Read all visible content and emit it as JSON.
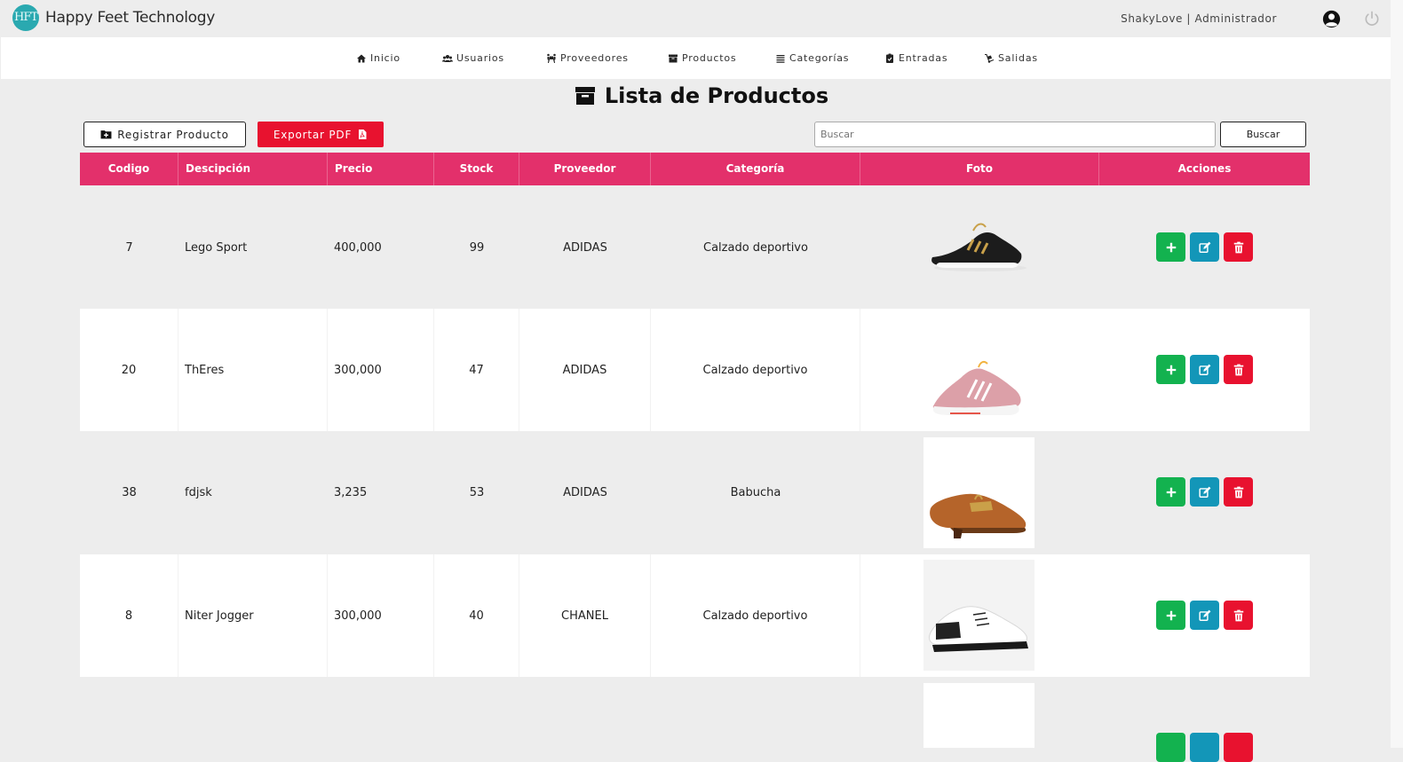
{
  "header": {
    "logo_text": "HFT",
    "brand": "Happy Feet Technology",
    "user": "ShakyLove | Administrador"
  },
  "nav": [
    {
      "label": "Inicio",
      "icon": "home-icon"
    },
    {
      "label": "Usuarios",
      "icon": "users-icon"
    },
    {
      "label": "Proveedores",
      "icon": "people-carry-icon"
    },
    {
      "label": "Productos",
      "icon": "archive-icon"
    },
    {
      "label": "Categorías",
      "icon": "list-icon"
    },
    {
      "label": "Entradas",
      "icon": "clipboard-check-icon"
    },
    {
      "label": "Salidas",
      "icon": "dolly-icon"
    }
  ],
  "page": {
    "title": "Lista de Productos",
    "register_label": "Registrar Producto",
    "export_label": "Exportar PDF",
    "search_placeholder": "Buscar",
    "search_button": "Buscar"
  },
  "table": {
    "columns": [
      "Codigo",
      "Descipción",
      "Precio",
      "Stock",
      "Proveedor",
      "Categoría",
      "Foto",
      "Acciones"
    ],
    "rows": [
      {
        "codigo": "7",
        "descripcion": "Lego Sport",
        "precio": "400,000",
        "stock": "99",
        "proveedor": "ADIDAS",
        "categoria": "Calzado deportivo",
        "foto": "black-sneaker"
      },
      {
        "codigo": "20",
        "descripcion": "ThEres",
        "precio": "300,000",
        "stock": "47",
        "proveedor": "ADIDAS",
        "categoria": "Calzado deportivo",
        "foto": "pink-sneaker"
      },
      {
        "codigo": "38",
        "descripcion": "fdjsk",
        "precio": "3,235",
        "stock": "53",
        "proveedor": "ADIDAS",
        "categoria": "Babucha",
        "foto": "brown-loafer"
      },
      {
        "codigo": "8",
        "descripcion": "Niter Jogger",
        "precio": "300,000",
        "stock": "40",
        "proveedor": "CHANEL",
        "categoria": "Calzado deportivo",
        "foto": "white-sneaker"
      }
    ]
  },
  "colors": {
    "header_bg": "#e3306b",
    "add": "#13b24f",
    "edit": "#1396b8",
    "delete": "#e8122f"
  }
}
